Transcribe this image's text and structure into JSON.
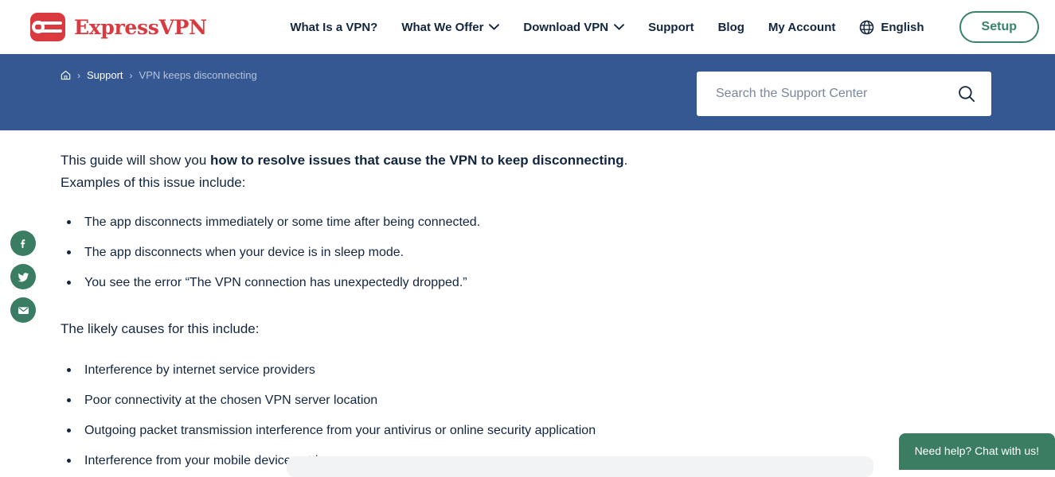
{
  "brand": {
    "name": "ExpressVPN",
    "logo_icon": "expressvpn-logo-icon",
    "color": "#da3940"
  },
  "nav": {
    "items": [
      {
        "label": "What Is a VPN?",
        "has_dropdown": false
      },
      {
        "label": "What We Offer",
        "has_dropdown": true
      },
      {
        "label": "Download VPN",
        "has_dropdown": true
      },
      {
        "label": "Support",
        "has_dropdown": false
      },
      {
        "label": "Blog",
        "has_dropdown": false
      },
      {
        "label": "My Account",
        "has_dropdown": false
      }
    ],
    "language": {
      "label": "English",
      "icon": "globe-icon"
    },
    "setup_button": {
      "label": "Setup",
      "color": "#3a8268"
    }
  },
  "band": {
    "background": "#355892",
    "breadcrumb": {
      "home_icon": "home-icon",
      "separator": "›",
      "items": [
        {
          "label": "Support",
          "current": false
        },
        {
          "label": "VPN keeps disconnecting",
          "current": true
        }
      ]
    },
    "search": {
      "placeholder": "Search the Support Center",
      "value": "",
      "icon": "search-icon"
    }
  },
  "social": {
    "color": "#3a7d63",
    "items": [
      {
        "name": "facebook-share-button",
        "glyph": "f"
      },
      {
        "name": "twitter-share-button",
        "glyph": "twitter-icon"
      },
      {
        "name": "email-share-button",
        "glyph": "envelope-icon"
      }
    ]
  },
  "article": {
    "intro": {
      "before_bold": "This guide will show you ",
      "bold": "how to resolve issues that cause the VPN to keep disconnecting",
      "after_bold": ". Examples of this issue include:"
    },
    "symptoms": [
      "The app disconnects immediately or some time after being connected.",
      "The app disconnects when your device is in sleep mode.",
      "You see the error “The VPN connection has unexpectedly dropped.”"
    ],
    "causes_heading": "The likely causes for this include:",
    "causes": [
      "Interference by internet service providers",
      "Poor connectivity at the chosen VPN server location",
      "Outgoing packet transmission interference from your antivirus or online security application",
      "Interference from your mobile device settings"
    ]
  },
  "chat": {
    "label": "Need help? Chat with us!",
    "color": "#3a7d63"
  }
}
